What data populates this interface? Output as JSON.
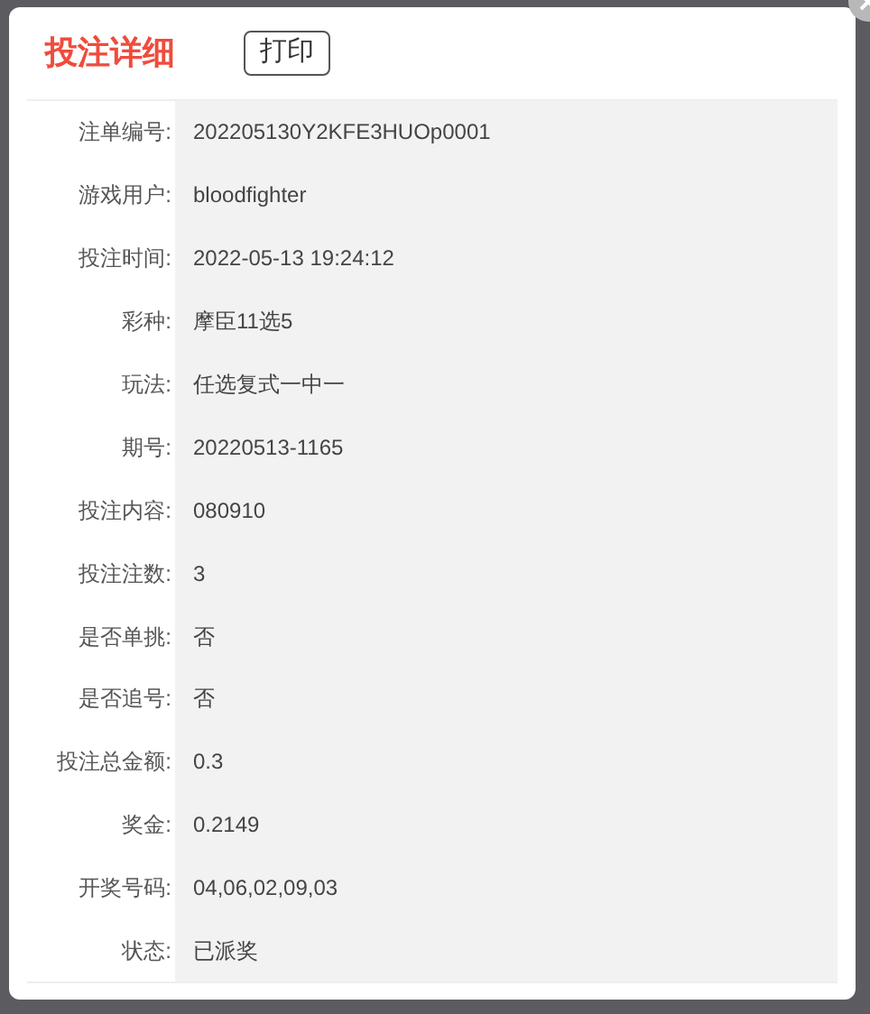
{
  "dialog": {
    "title": "投注详细",
    "print_button": "打印"
  },
  "fields": [
    {
      "label": "注单编号:",
      "value": "202205130Y2KFE3HUOp0001"
    },
    {
      "label": "游戏用户:",
      "value": "bloodfighter"
    },
    {
      "label": "投注时间:",
      "value": "2022-05-13 19:24:12"
    },
    {
      "label": "彩种:",
      "value": "摩臣11选5"
    },
    {
      "label": "玩法:",
      "value": "任选复式一中一"
    },
    {
      "label": "期号:",
      "value": "20220513-1165"
    },
    {
      "label": "投注内容:",
      "value": "080910"
    },
    {
      "label": "投注注数:",
      "value": "3"
    },
    {
      "label": "是否单挑:",
      "value": "否"
    },
    {
      "label": "是否追号:",
      "value": "否"
    },
    {
      "label": "投注总金额:",
      "value": "0.3"
    },
    {
      "label": "奖金:",
      "value": "0.2149"
    },
    {
      "label": "开奖号码:",
      "value": "04,06,02,09,03"
    },
    {
      "label": "状态:",
      "value": "已派奖"
    }
  ]
}
